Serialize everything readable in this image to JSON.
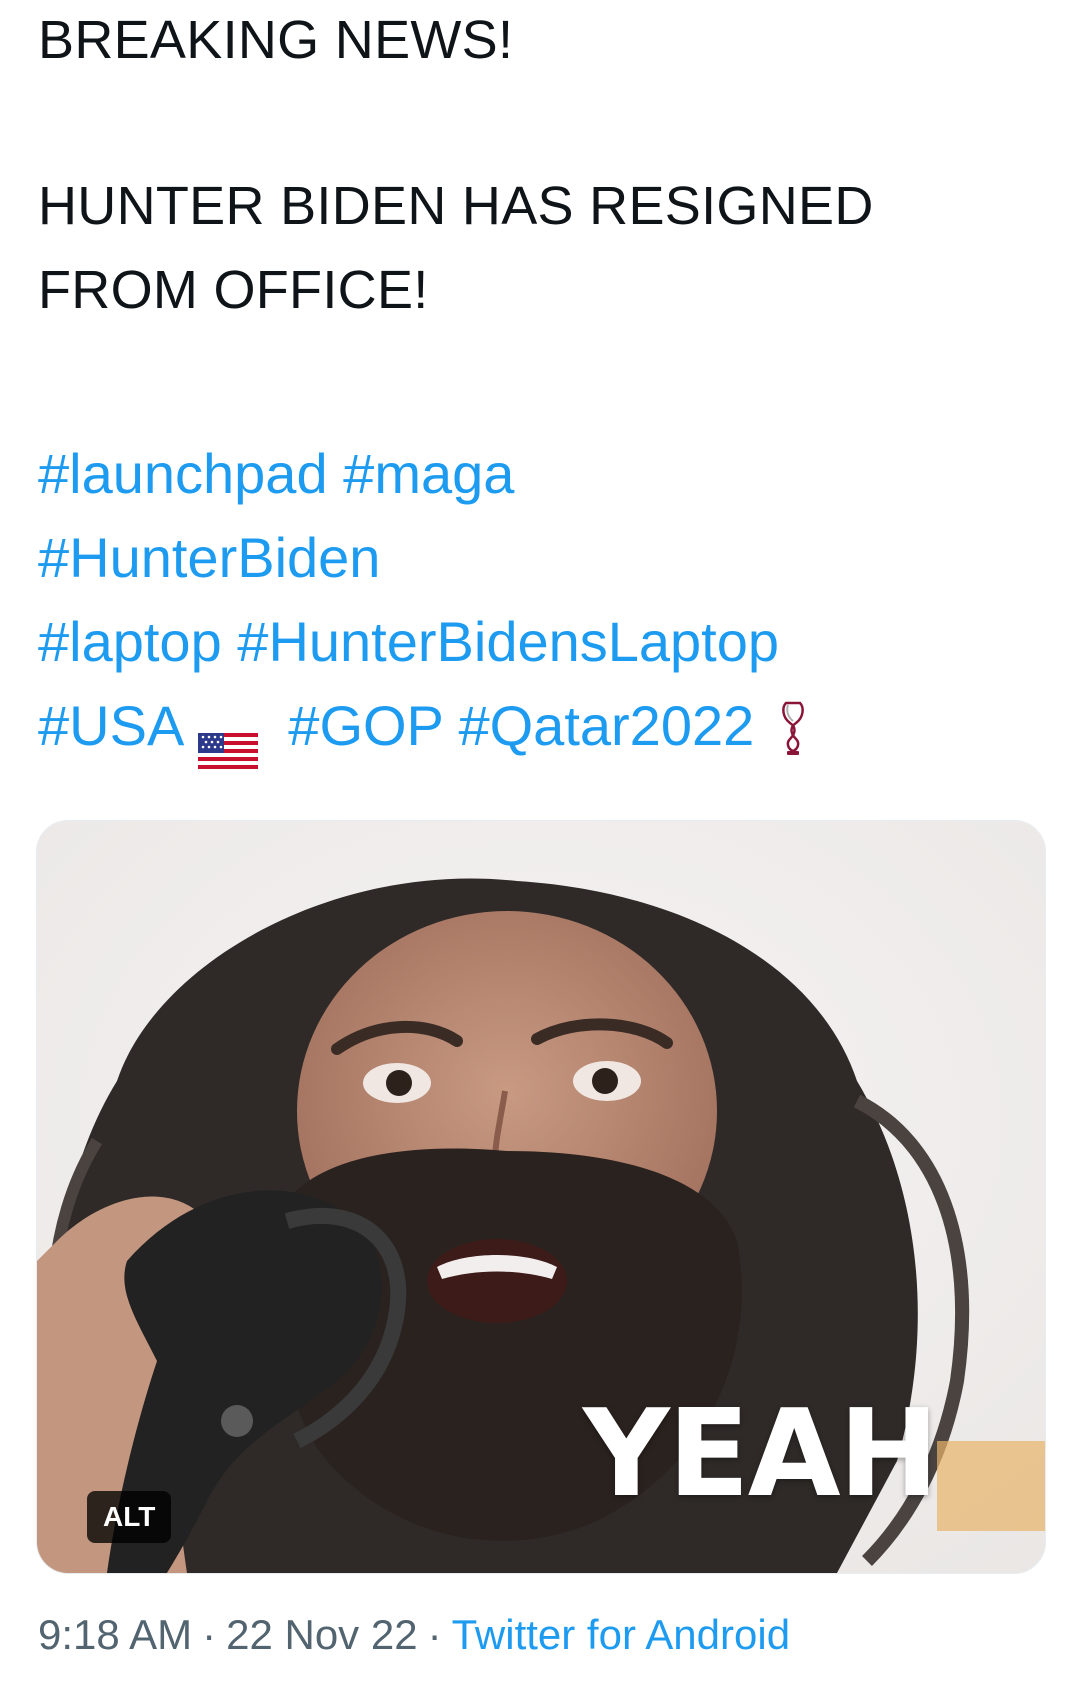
{
  "tweet": {
    "lines": [
      "BREAKING NEWS!",
      "HUNTER BIDEN HAS RESIGNED",
      "FROM OFFICE!"
    ],
    "hashtag_rows": [
      [
        "#launchpad",
        "#maga"
      ],
      [
        "#HunterBiden"
      ],
      [
        "#laptop",
        "#HunterBidensLaptop"
      ],
      [
        "#USA",
        "#GOP",
        "#Qatar2022"
      ]
    ],
    "emojis": {
      "after_usa": "us-flag-icon",
      "after_qatar": "world-cup-trophy-icon"
    },
    "media": {
      "overlay_text": "YEAH",
      "alt_badge": "ALT"
    },
    "meta": {
      "time": "9:18 AM",
      "separator": "·",
      "date": "22 Nov 22",
      "source": "Twitter for Android"
    }
  },
  "colors": {
    "text": "#0f1419",
    "link": "#1d9bf0",
    "meta": "#536471",
    "alt_badge_bg": "#000000"
  }
}
